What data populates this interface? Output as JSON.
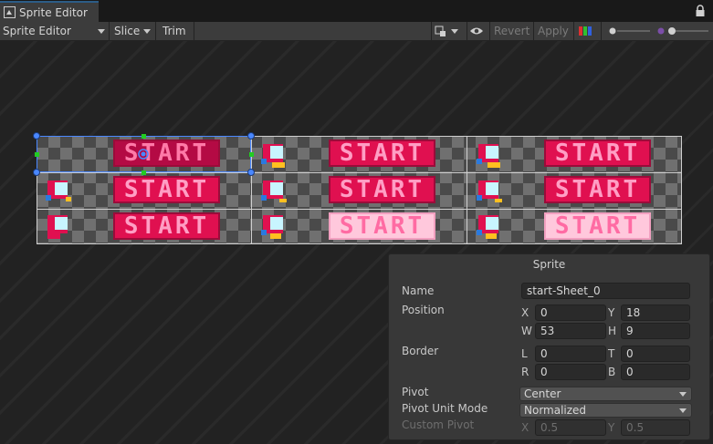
{
  "window": {
    "tab_title": "Sprite Editor",
    "tab_icon": "sprite-editor-icon"
  },
  "toolbar": {
    "mode": "Sprite Editor",
    "slice": "Slice",
    "trim": "Trim",
    "revert": "Revert",
    "apply": "Apply"
  },
  "sheet": {
    "button_text": "START",
    "selected_cell": "start-Sheet_0"
  },
  "sprite_panel": {
    "title": "Sprite",
    "name_label": "Name",
    "name_value": "start-Sheet_0",
    "position_label": "Position",
    "x_label": "X",
    "x_value": "0",
    "y_label": "Y",
    "y_value": "18",
    "w_label": "W",
    "w_value": "53",
    "h_label": "H",
    "h_value": "9",
    "border_label": "Border",
    "l_label": "L",
    "l_value": "0",
    "t_label": "T",
    "t_value": "0",
    "r_label": "R",
    "r_value": "0",
    "b_label": "B",
    "b_value": "0",
    "pivot_label": "Pivot",
    "pivot_value": "Center",
    "pivot_unit_label": "Pivot Unit Mode",
    "pivot_unit_value": "Normalized",
    "custom_pivot_label": "Custom Pivot",
    "cx_label": "X",
    "cx_value": "0.5",
    "cy_label": "Y",
    "cy_value": "0.5"
  },
  "colors": {
    "accent": "#4a88ff",
    "button_pink": "#e01050",
    "button_pale": "#ffc8dc"
  }
}
